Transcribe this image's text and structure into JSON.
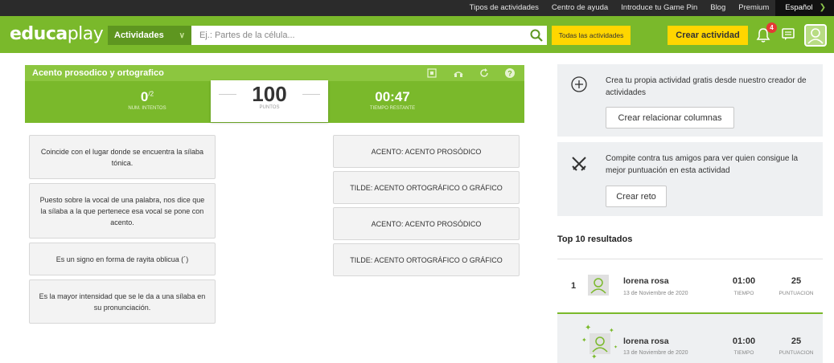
{
  "topbar": {
    "links": [
      "Tipos de actividades",
      "Centro de ayuda",
      "Introduce tu Game Pin",
      "Blog",
      "Premium"
    ],
    "language": "Español"
  },
  "header": {
    "logo_bold": "educa",
    "logo_thin": "play",
    "activities_label": "Actividades",
    "search_placeholder": "Ej.: Partes de la célula...",
    "all_activities": "Todas las actividades",
    "create_activity": "Crear actividad",
    "notification_count": "4"
  },
  "game": {
    "title": "Acento prosodico y ortografico",
    "attempts_value": "0",
    "attempts_total": "/2",
    "attempts_label": "NUM. INTENTOS",
    "points_value": "100",
    "points_label": "PUNTOS",
    "time_value": "00:47",
    "time_label": "TIEMPO RESTANTE"
  },
  "left_cards": [
    "Coincide con el lugar donde se encuentra la sílaba tónica.",
    "Puesto sobre la vocal de una palabra, nos dice que la sílaba a la que pertenece esa vocal se pone con acento.",
    "Es un signo en forma de rayita oblicua (´)",
    "Es la mayor intensidad que se le da a una sílaba en su pronunciación."
  ],
  "right_cards": [
    "ACENTO: ACENTO PROSÓDICO",
    "TILDE: ACENTO ORTOGRÁFICO O GRÁFICO",
    "ACENTO: ACENTO PROSÓDICO",
    "TILDE: ACENTO ORTOGRÁFICO O GRÁFICO"
  ],
  "sidebar": {
    "create_text": "Crea tu propia actividad gratis desde nuestro creador de actividades",
    "create_button": "Crear relacionar columnas",
    "challenge_text": "Compite contra tus amigos para ver quien consigue la mejor puntuación en esta actividad",
    "challenge_button": "Crear reto",
    "top10_title": "Top 10 resultados",
    "results": [
      {
        "rank": "1",
        "name": "lorena rosa",
        "date": "13 de Noviembre de 2020",
        "time": "01:00",
        "time_label": "TIEMPO",
        "score": "25",
        "score_label": "PUNTUACION"
      },
      {
        "rank": "",
        "name": "lorena rosa",
        "date": "13 de Noviembre de 2020",
        "time": "01:00",
        "time_label": "TIEMPO",
        "score": "25",
        "score_label": "PUNTUACION"
      }
    ]
  },
  "colors": {
    "brand_green": "#7ab92b",
    "accent_yellow": "#ffd600",
    "badge_red": "#e53935"
  }
}
